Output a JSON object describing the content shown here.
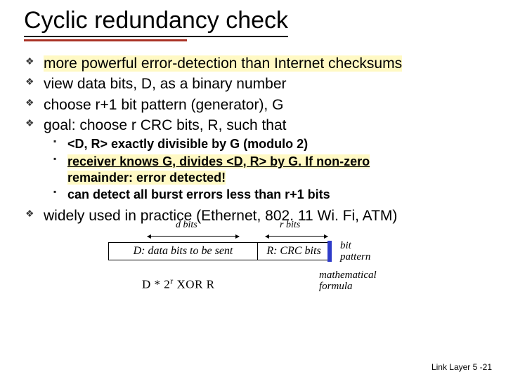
{
  "title": "Cyclic redundancy check",
  "bullets": {
    "b1": "more powerful error-detection than Internet checksums",
    "b2": "view data bits, D, as a binary number",
    "b3": "choose r+1 bit pattern (generator), G",
    "b4": "goal: choose r CRC bits, R, such that",
    "b5": "widely used in practice (Ethernet, 802. 11 Wi. Fi, ATM)"
  },
  "sub": {
    "s1": "<D, R> exactly divisible by G (modulo 2)",
    "s2a": "receiver knows G, divides <D, R> by G.  If non-zero",
    "s2b": "remainder: error detected!",
    "s3": "can detect all burst errors less than r+1 bits"
  },
  "diagram": {
    "dbits": "d bits",
    "rbits": "r bits",
    "cell_d": "D: data bits to be sent",
    "cell_r": "R: CRC bits",
    "bitpattern_l1": "bit",
    "bitpattern_l2": "pattern",
    "formula_pre": "D * 2",
    "formula_sup": "r",
    "formula_post": "   XOR   R",
    "mathformula_l1": "mathematical",
    "mathformula_l2": "formula"
  },
  "footer": "Link Layer  5 -21"
}
